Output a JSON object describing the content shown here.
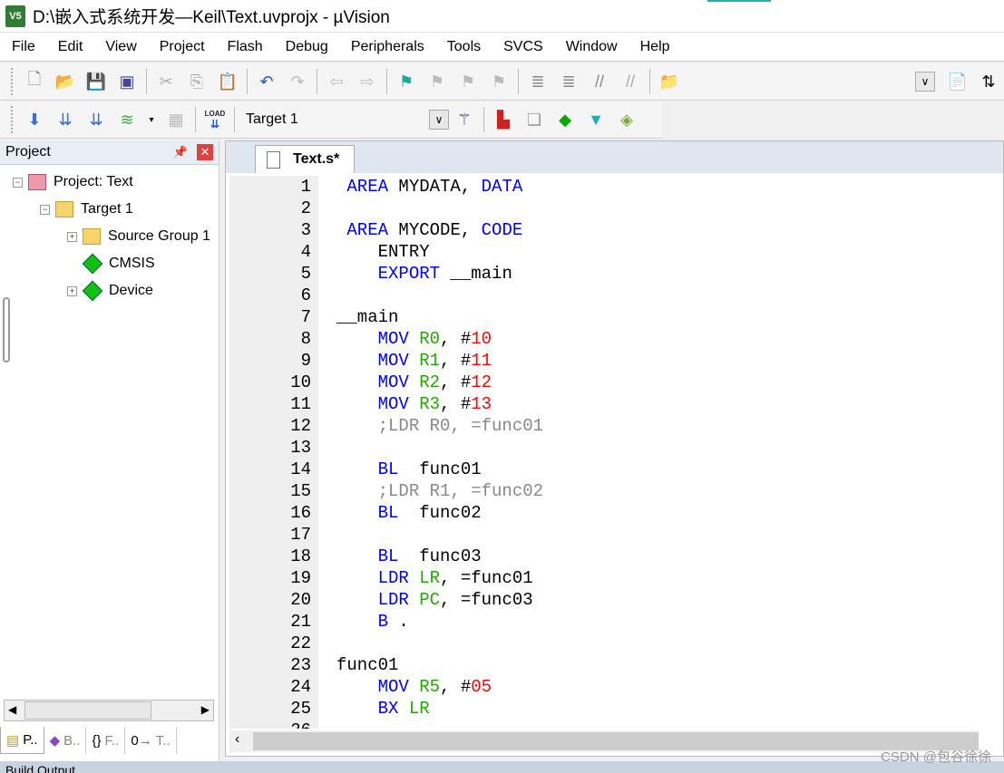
{
  "window": {
    "title": "D:\\嵌入式系统开发—Keil\\Text.uvprojx - µVision",
    "logo": "V5"
  },
  "menu": [
    "File",
    "Edit",
    "View",
    "Project",
    "Flash",
    "Debug",
    "Peripherals",
    "Tools",
    "SVCS",
    "Window",
    "Help"
  ],
  "toolbar1": [
    "new-file-icon",
    "open-folder-icon",
    "save-icon",
    "save-all-icon",
    "cut-icon",
    "copy-icon",
    "paste-icon",
    "undo-icon",
    "redo-icon",
    "nav-back-icon",
    "nav-forward-icon",
    "bookmark-icon",
    "prev-bookmark-icon",
    "next-bookmark-icon",
    "clear-bookmarks-icon",
    "indent-icon",
    "unindent-icon",
    "comment-icon",
    "uncomment-icon",
    "find-in-files-icon"
  ],
  "toolbar2": {
    "target": "Target 1",
    "load_label": "LOAD"
  },
  "project_panel": {
    "title": "Project",
    "tree": [
      {
        "label": "Project: Text",
        "level": 0,
        "expander": "−"
      },
      {
        "label": "Target 1",
        "level": 1,
        "expander": "−"
      },
      {
        "label": "Source Group 1",
        "level": 2,
        "expander": "+"
      },
      {
        "label": "CMSIS",
        "level": 2,
        "expander": ""
      },
      {
        "label": "Device",
        "level": 2,
        "expander": "+"
      }
    ],
    "tabs": [
      "P..",
      "B..",
      "F..",
      "T.."
    ]
  },
  "editor": {
    "tab": "Text.s*",
    "lines": [
      [
        [
          " AREA",
          "kw"
        ],
        [
          " MYDATA, ",
          "pl"
        ],
        [
          "DATA",
          "kw"
        ]
      ],
      [],
      [
        [
          " AREA",
          "kw"
        ],
        [
          " MYCODE, ",
          "pl"
        ],
        [
          "CODE",
          "kw"
        ]
      ],
      [
        [
          "    ENTRY",
          "pl"
        ]
      ],
      [
        [
          "    EXPORT",
          "kw"
        ],
        [
          " __main",
          "pl"
        ]
      ],
      [],
      [
        [
          "__main",
          "pl"
        ]
      ],
      [
        [
          "    MOV",
          "kw"
        ],
        [
          " ",
          "pl"
        ],
        [
          "R0",
          "reg"
        ],
        [
          ", #",
          "pl"
        ],
        [
          "10",
          "num"
        ]
      ],
      [
        [
          "    MOV",
          "kw"
        ],
        [
          " ",
          "pl"
        ],
        [
          "R1",
          "reg"
        ],
        [
          ", #",
          "pl"
        ],
        [
          "11",
          "num"
        ]
      ],
      [
        [
          "    MOV",
          "kw"
        ],
        [
          " ",
          "pl"
        ],
        [
          "R2",
          "reg"
        ],
        [
          ", #",
          "pl"
        ],
        [
          "12",
          "num"
        ]
      ],
      [
        [
          "    MOV",
          "kw"
        ],
        [
          " ",
          "pl"
        ],
        [
          "R3",
          "reg"
        ],
        [
          ", #",
          "pl"
        ],
        [
          "13",
          "num"
        ]
      ],
      [
        [
          "    ;LDR R0, =func01",
          "cm"
        ]
      ],
      [],
      [
        [
          "    BL",
          "kw"
        ],
        [
          "  func01",
          "pl"
        ]
      ],
      [
        [
          "    ;LDR R1, =func02",
          "cm"
        ]
      ],
      [
        [
          "    BL",
          "kw"
        ],
        [
          "  func02",
          "pl"
        ]
      ],
      [],
      [
        [
          "    BL",
          "kw"
        ],
        [
          "  func03",
          "pl"
        ]
      ],
      [
        [
          "    LDR",
          "kw"
        ],
        [
          " ",
          "pl"
        ],
        [
          "LR",
          "reg"
        ],
        [
          ", =func01",
          "pl"
        ]
      ],
      [
        [
          "    LDR",
          "kw"
        ],
        [
          " ",
          "pl"
        ],
        [
          "PC",
          "reg"
        ],
        [
          ", =func03",
          "pl"
        ]
      ],
      [
        [
          "    B",
          "kw"
        ],
        [
          " .",
          "pl"
        ]
      ],
      [],
      [
        [
          "func01",
          "pl"
        ]
      ],
      [
        [
          "    MOV",
          "kw"
        ],
        [
          " ",
          "pl"
        ],
        [
          "R5",
          "reg"
        ],
        [
          ", #",
          "pl"
        ],
        [
          "05",
          "num"
        ]
      ],
      [
        [
          "    BX",
          "kw"
        ],
        [
          " ",
          "pl"
        ],
        [
          "LR",
          "reg"
        ]
      ],
      []
    ]
  },
  "bottom_panel": "Build Output",
  "watermark": "CSDN @包谷徐徐"
}
